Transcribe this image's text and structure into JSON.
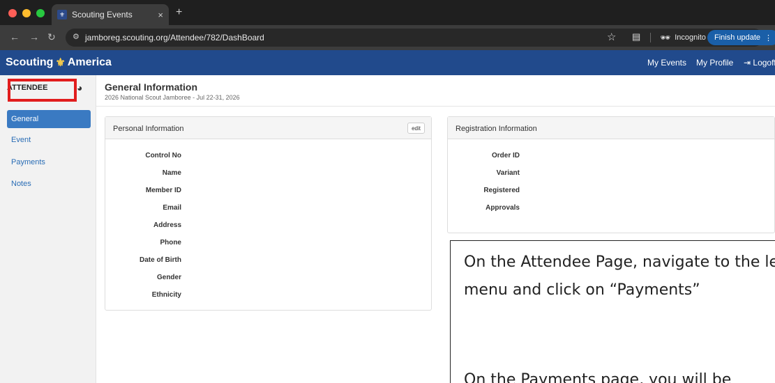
{
  "browser": {
    "tab_title": "Scouting Events",
    "tab_close": "×",
    "new_tab": "+",
    "url": "jamboreg.scouting.org/Attendee/782/DashBoard",
    "incognito_label": "Incognito",
    "finish_update_label": "Finish update",
    "icons": [
      "back-arrow-icon",
      "forward-arrow-icon",
      "reload-icon",
      "site-settings-icon",
      "bookmark-star-icon",
      "reading-list-icon",
      "incognito-icon",
      "more-vert-icon"
    ]
  },
  "app_nav": {
    "brand_left": "Scouting",
    "brand_right": "America",
    "my_events": "My Events",
    "my_profile": "My Profile",
    "logoff": "Logoff"
  },
  "sidebar": {
    "header": "ATTENDEE",
    "items": [
      {
        "label": "General",
        "active": true
      },
      {
        "label": "Event",
        "active": false
      },
      {
        "label": "Payments",
        "active": false
      },
      {
        "label": "Notes",
        "active": false
      }
    ]
  },
  "page": {
    "title": "General Information",
    "subtitle": "2026 National Scout Jamboree - Jul 22-31, 2026"
  },
  "personal_panel": {
    "title": "Personal Information",
    "edit_label": "edit",
    "fields": [
      "Control No",
      "Name",
      "Member ID",
      "Email",
      "Address",
      "Phone",
      "Date of Birth",
      "Gender",
      "Ethnicity"
    ]
  },
  "registration_panel": {
    "title": "Registration Information",
    "fields": [
      "Order ID",
      "Variant",
      "Registered",
      "Approvals"
    ]
  },
  "overlay": {
    "line1": "On the Attendee Page, navigate to the left",
    "line2": "menu and click on “Payments”",
    "line3": "On the Payments page, you will be"
  },
  "colors": {
    "nav_blue": "#214a8c",
    "active_blue": "#3a7ac2",
    "highlight_red": "#e11d1d"
  }
}
